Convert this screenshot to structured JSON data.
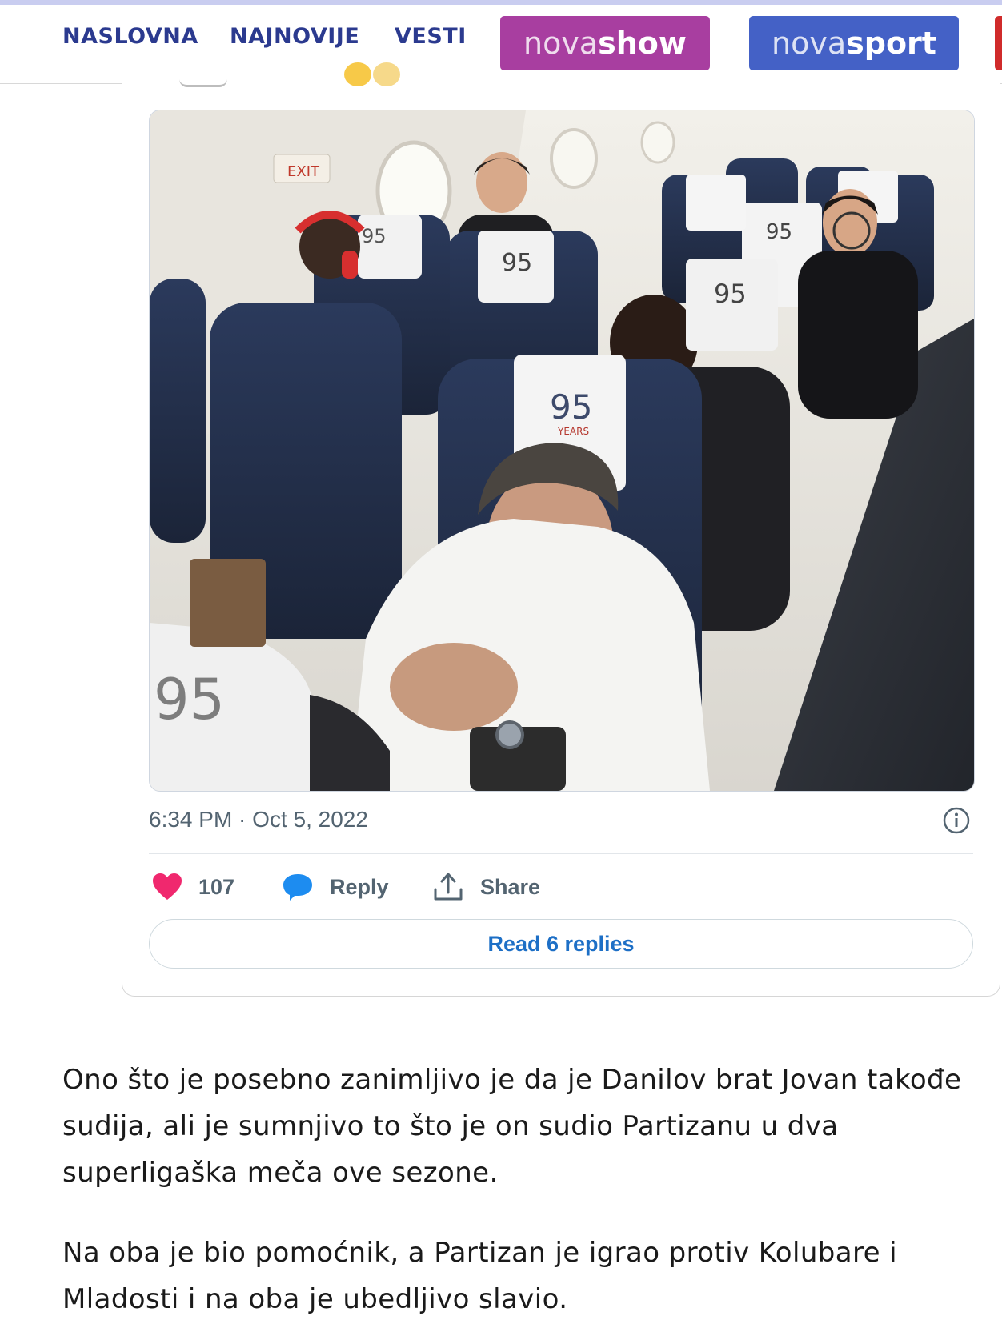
{
  "nav": {
    "links": [
      "NASLOVNA",
      "NAJNOVIJE",
      "VESTI"
    ],
    "brand_show": {
      "part1": "nova",
      "part2": "show",
      "color": "#a83ea0"
    },
    "brand_sport": {
      "part1": "nova",
      "part2": "sport",
      "color": "#4461c6"
    }
  },
  "tweet": {
    "photo_icon": "airplane-cabin-photo",
    "timestamp": "6:34 PM · Oct 5, 2022",
    "likes": "107",
    "reply_label": "Reply",
    "share_label": "Share",
    "read_replies_label": "Read 6 replies",
    "accent_color": "#1d6fc6",
    "heart_color": "#f0286e"
  },
  "article": {
    "paragraphs": [
      "Ono što je posebno zanimljivo je da je Danilov brat Jovan takođe sudija, ali je sumnjivo to što je on sudio Partizanu u dva superligaška meča ove sezone.",
      "Na oba je bio pomoćnik, a Partizan je igrao protiv Kolubare i Mladosti i na oba je ubedljivo slavio."
    ]
  }
}
